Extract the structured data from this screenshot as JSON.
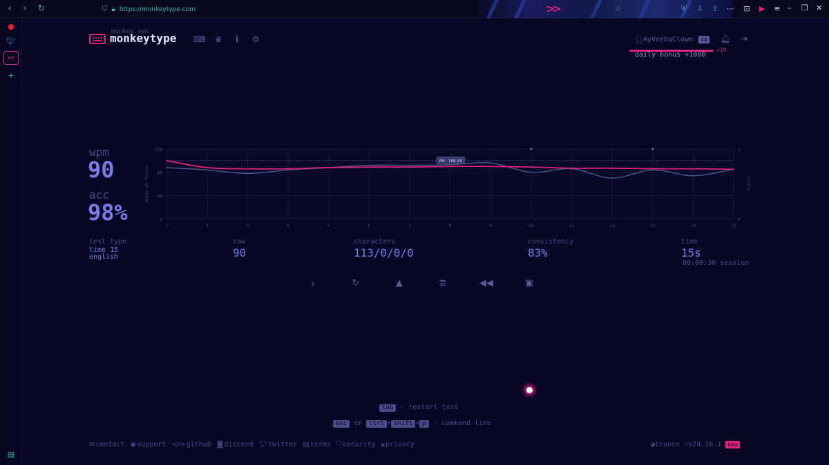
{
  "browser": {
    "url": "https://monkeytype.com",
    "back_icon": "chevron-left-icon",
    "forward_icon": "chevron-right-icon",
    "reload_icon": "reload-icon"
  },
  "header": {
    "logo_top": "monkey see",
    "logo": "monkeytype",
    "username": "AyVeeDaClown",
    "level": "44",
    "xp_gain": "+19",
    "daily_bonus": "daily bonus +1000"
  },
  "result": {
    "wpm_label": "wpm",
    "wpm": "90",
    "acc_label": "acc",
    "acc": "98%",
    "test_type_label": "test type",
    "test_type_line1": "time 15",
    "test_type_line2": "english",
    "raw_label": "raw",
    "raw": "90",
    "characters_label": "characters",
    "characters": "113/0/0/0",
    "consistency_label": "consistency",
    "consistency": "83%",
    "time_label": "time",
    "time": "15s",
    "session": "00:00:30 session"
  },
  "chart_data": {
    "type": "line",
    "x": [
      1,
      2,
      3,
      4,
      5,
      6,
      7,
      8,
      9,
      10,
      11,
      12,
      13,
      14,
      15
    ],
    "y_ticks": [
      "0",
      "40",
      "80",
      "120"
    ],
    "y2_ticks": [
      "0",
      "1"
    ],
    "ylim": [
      0,
      120
    ],
    "y2lim": [
      0,
      1
    ],
    "ylabel": "Words per Minute",
    "y2label": "Errors",
    "pb_label": "PB: 108.60",
    "pb_value": 100,
    "series": [
      {
        "values": [
          100,
          88,
          86,
          86,
          88,
          89,
          89,
          90,
          90,
          89,
          87,
          87,
          86,
          86,
          85
        ],
        "color": "#e0217c"
      },
      {
        "values": [
          88,
          84,
          78,
          84,
          88,
          92,
          92,
          93,
          96,
          80,
          86,
          70,
          84,
          74,
          85
        ],
        "color": "#4a5a8a"
      }
    ],
    "errors": [
      0,
      0,
      0,
      0,
      0,
      0,
      0,
      0,
      0,
      1,
      0,
      0,
      1,
      0,
      0
    ]
  },
  "hints": {
    "tab_key": "tab",
    "tab_text": "- restart test",
    "esc_key": "esc",
    "or": "or",
    "ctrl_key": "ctrl",
    "shift_key": "shift",
    "p_key": "p",
    "plus": "+",
    "cmd_text": "- command line"
  },
  "footer": {
    "contact": "contact",
    "support": "support",
    "github": "github",
    "discord": "discord",
    "twitter": "twitter",
    "terms": "terms",
    "security": "security",
    "privacy": "privacy",
    "theme": "trance",
    "version": "v24.18.1",
    "new": "new"
  },
  "colors": {
    "background": "#060625",
    "accent": "#e0217c",
    "text": "#7b7be8",
    "sub": "#4a4a88"
  }
}
